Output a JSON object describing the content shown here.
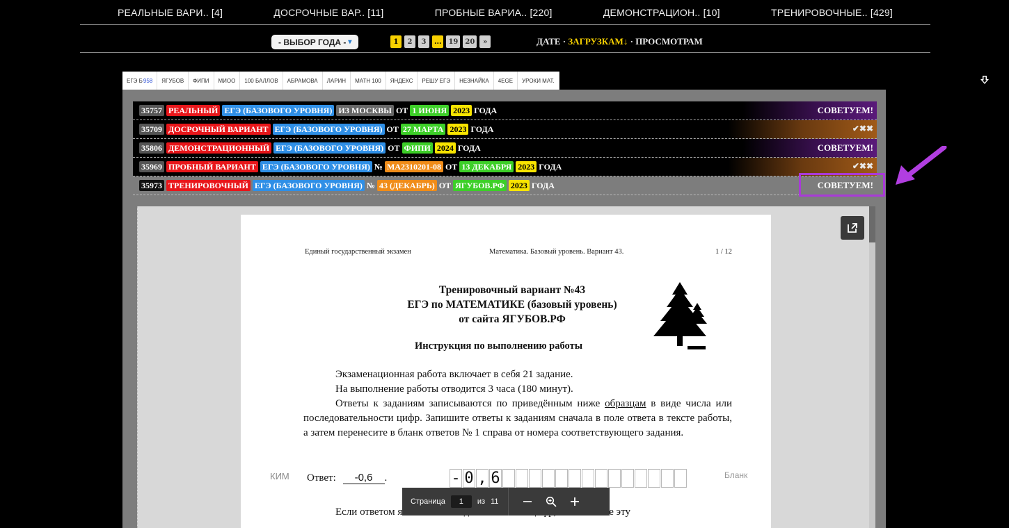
{
  "categories": [
    "РЕАЛЬНЫЕ ВАРИ.. [4]",
    "ДОСРОЧНЫЕ ВАР.. [11]",
    "ПРОБНЫЕ ВАРИА.. [220]",
    "ДЕМОНСТРАЦИОН.. [10]",
    "ТРЕНИРОВОЧНЫЕ.. [429]"
  ],
  "toolbar": {
    "year_label": "- ВЫБОР ГОДА -",
    "pages": [
      "1",
      "2",
      "3",
      "...",
      "19",
      "20",
      "»"
    ],
    "sort_prefix": "ДАТЕ",
    "sort_active": "ЗАГРУЗКАМ↓",
    "sort_other": "ПРОСМОТРАМ"
  },
  "tabs": [
    {
      "label": "ЕГЭ Б",
      "count": "958"
    },
    {
      "label": "ЯГУБОВ"
    },
    {
      "label": "ФИПИ"
    },
    {
      "label": "МИОО"
    },
    {
      "label": "100 БАЛЛОВ"
    },
    {
      "label": "АБРАМОВА"
    },
    {
      "label": "ЛАРИН"
    },
    {
      "label": "MATH 100"
    },
    {
      "label": "ЯНДЕКС"
    },
    {
      "label": "РЕШУ ЕГЭ"
    },
    {
      "label": "НЕЗНАЙКА"
    },
    {
      "label": "4EGE"
    },
    {
      "label": "УРОКИ МАТ."
    }
  ],
  "variants": [
    {
      "id": "35757",
      "type": "РЕАЛЬНЫЙ",
      "exam": "ЕГЭ (БАЗОВОГО УРОВНЯ)",
      "extra": "ИЗ МОСКВЫ",
      "from_word": "ОТ",
      "source": "1 ИЮНЯ",
      "year": "2023",
      "suffix": "ГОДА",
      "right": "СОВЕТУЕМ!"
    },
    {
      "id": "35709",
      "type": "ДОСРОЧНЫЙ ВАРИАНТ",
      "exam": "ЕГЭ (БАЗОВОГО УРОВНЯ)",
      "from_word": "ОТ",
      "source": "27 МАРТА",
      "year": "2023",
      "suffix": "ГОДА",
      "right": "✔✖✖"
    },
    {
      "id": "35806",
      "type": "ДЕМОНСТРАЦИОННЫЙ",
      "exam": "ЕГЭ (БАЗОВОГО УРОВНЯ)",
      "from_word": "ОТ",
      "source": "ФИПИ",
      "year": "2024",
      "suffix": "ГОДА",
      "right": "СОВЕТУЕМ!"
    },
    {
      "id": "35969",
      "type": "ПРОБНЫЙ ВАРИАНТ",
      "exam": "ЕГЭ (БАЗОВОГО УРОВНЯ)",
      "num_word": "№",
      "num": "МА2310201-08",
      "from_word": "ОТ",
      "source": "13 ДЕКАБРЯ",
      "year": "2023",
      "suffix": "ГОДА",
      "right": "✔✖✖"
    },
    {
      "id": "35973",
      "type": "ТРЕНИРОВОЧНЫЙ",
      "exam": "ЕГЭ (БАЗОВОГО УРОВНЯ)",
      "num_word": "№",
      "num": "43 (ДЕКАБРЬ)",
      "from_word": "ОТ",
      "source": "ЯГУБОВ.РФ",
      "year": "2023",
      "suffix": "ГОДА",
      "right": "СОВЕТУЕМ!"
    }
  ],
  "document": {
    "header_left": "Единый государственный экзамен",
    "header_center": "Математика. Базовый уровень. Вариант 43.",
    "header_right": "1 / 12",
    "title_1": "Тренировочный вариант №43",
    "title_2": "ЕГЭ по МАТЕМАТИКЕ (базовый уровень)",
    "title_3": "от сайта ЯГУБОВ.РФ",
    "instruction_title": "Инструкция по выполнению работы",
    "para_1": "Экзаменационная работа включает в себя 21 задание.",
    "para_2": "На выполнение работы отводится 3 часа (180 минут).",
    "para_3_a": "Ответы к заданиям записываются по приведённым ниже",
    "para_3_link": "образцам",
    "para_3_b": "в виде числа или последовательности цифр. Запишите ответы к заданиям сначала в поле ответа в тексте работы, а затем перенесите в бланк ответов № 1 справа от номера соответствующего задания.",
    "kim_label": "КИМ",
    "answer_label": "Ответ:",
    "answer_value": "-0,6",
    "answer_cells": [
      "-",
      "0",
      ",",
      "6",
      "",
      "",
      "",
      "",
      "",
      "",
      "",
      "",
      "",
      "",
      "",
      "",
      "",
      ""
    ],
    "blank_label": "Бланк",
    "para_4": "Если ответом является последовательность цифр, то запишите эту"
  },
  "pdf_toolbar": {
    "page_label": "Страница",
    "page_value": "1",
    "of_label": "из",
    "total": "11"
  },
  "colors": {
    "accent_yellow": "#f7d000",
    "badge_red": "#e8161a",
    "badge_blue": "#2f8fe6",
    "badge_green": "#3dcf28",
    "highlight_purple": "#a93ad8"
  }
}
